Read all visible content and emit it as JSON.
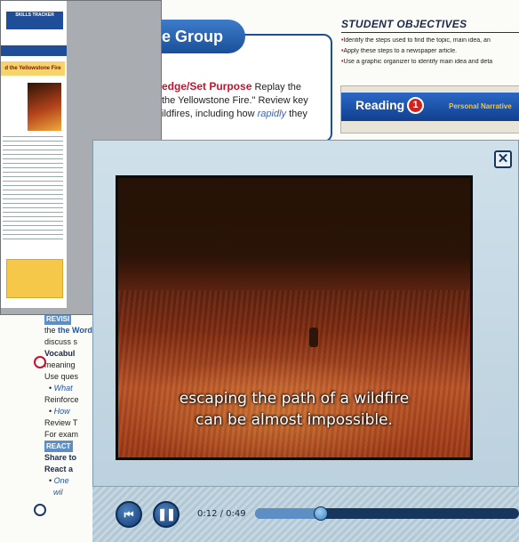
{
  "background_page": {
    "group_pill": "e Group",
    "purpose_heading": "edge/Set Purpose",
    "purpose_text_1": "Replay the",
    "purpose_text_2": "the Yellowstone Fire.\" Review key",
    "purpose_text_3": "ildfires, including how",
    "purpose_text_rapidly": "rapidly",
    "purpose_text_4": "they",
    "objectives_title": "STUDENT OBJECTIVES",
    "objectives": [
      "Identify the steps used to find the topic, main idea, an",
      "Apply these steps to a newspaper article.",
      "Use a graphic organizer to identify main idea and deta"
    ],
    "reading_label": "Reading",
    "reading_number": "1",
    "reading_type": "Personal Narrative",
    "left_column": {
      "revise": "REVISI",
      "word_line": "the Word",
      "discuss": "discuss s",
      "vocab_heading": "Vocabul",
      "meaning": "meaning",
      "use_ques": "Use ques",
      "bullet_1": "What",
      "reinforce": "Reinforce",
      "bullet_2": "How",
      "review": "Review T",
      "example": "For exam",
      "react_heading": "REACT",
      "share": "Share to",
      "react_a": "React a",
      "bullet_3": "One",
      "bullet_3b": "wil"
    }
  },
  "thumbnail": {
    "tracker_label": "SKILLS TRACKER",
    "article_title": "d the Yellowstone Fire"
  },
  "player": {
    "close_label": "✕",
    "subtitle_line_1": "escaping the path of a wildfire",
    "subtitle_line_2": "can be almost impossible.",
    "time_display": "0:12 / 0:49",
    "progress_fraction": 0.245,
    "prev_icon": "⏮",
    "pause_icon": "❚❚"
  }
}
